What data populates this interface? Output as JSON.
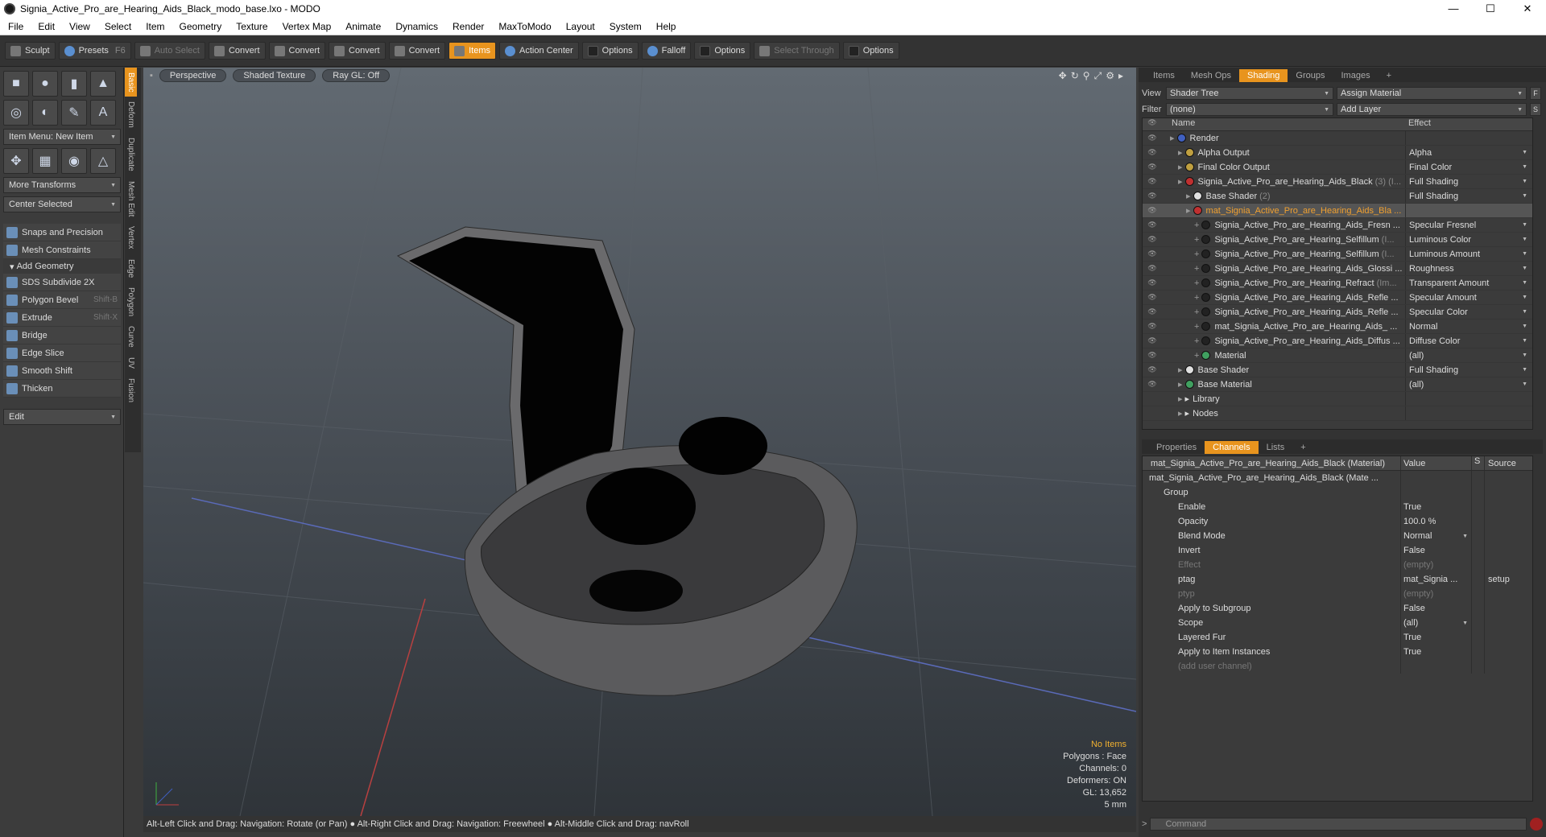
{
  "window": {
    "title": "Signia_Active_Pro_are_Hearing_Aids_Black_modo_base.lxo - MODO",
    "min": "—",
    "max": "☐",
    "close": "✕"
  },
  "menu": [
    "File",
    "Edit",
    "View",
    "Select",
    "Item",
    "Geometry",
    "Texture",
    "Vertex Map",
    "Animate",
    "Dynamics",
    "Render",
    "MaxToModo",
    "Layout",
    "System",
    "Help"
  ],
  "toolbar": {
    "sculpt": "Sculpt",
    "presets": "Presets",
    "presets_key": "F6",
    "auto_select": "Auto Select",
    "convert": "Convert",
    "items": "Items",
    "action_center": "Action Center",
    "options": "Options",
    "falloff": "Falloff",
    "select_through": "Select Through"
  },
  "left": {
    "item_menu": "Item Menu: New Item",
    "more_transforms": "More Transforms",
    "center_selected": "Center Selected",
    "snaps": "Snaps and Precision",
    "constraints": "Mesh Constraints",
    "add_geometry": "Add Geometry",
    "tools": [
      {
        "label": "SDS Subdivide 2X",
        "key": ""
      },
      {
        "label": "Polygon Bevel",
        "key": "Shift-B"
      },
      {
        "label": "Extrude",
        "key": "Shift-X"
      },
      {
        "label": "Bridge",
        "key": ""
      },
      {
        "label": "Edge Slice",
        "key": ""
      },
      {
        "label": "Smooth Shift",
        "key": ""
      },
      {
        "label": "Thicken",
        "key": ""
      }
    ],
    "edit": "Edit"
  },
  "vtabs": [
    "Basic",
    "Deform",
    "Duplicate",
    "Mesh Edit",
    "Vertex",
    "Edge",
    "Polygon",
    "Curve",
    "UV",
    "Fusion"
  ],
  "viewport": {
    "perspective": "Perspective",
    "shaded": "Shaded Texture",
    "raygl": "Ray GL: Off",
    "info": {
      "items": "No Items",
      "polygons": "Polygons : Face",
      "channels": "Channels: 0",
      "deformers": "Deformers: ON",
      "gl": "GL: 13,652",
      "scale": "5 mm"
    }
  },
  "status": "Alt-Left Click and Drag: Navigation: Rotate (or Pan) ● Alt-Right Click and Drag: Navigation: Freewheel ● Alt-Middle Click and Drag: navRoll",
  "right": {
    "tabs": [
      "Items",
      "Mesh Ops",
      "Shading",
      "Groups",
      "Images",
      "+"
    ],
    "view_label": "View",
    "view_value": "Shader Tree",
    "assign": "Assign Material",
    "f": "F",
    "filter_label": "Filter",
    "filter_value": "(none)",
    "add_layer": "Add Layer",
    "s": "S",
    "col_name": "Name",
    "col_effect": "Effect",
    "rows": [
      {
        "name": "Render",
        "dim": "",
        "effect": "",
        "indent": 1,
        "color": "#4060c0",
        "sel": false
      },
      {
        "name": "Alpha Output",
        "dim": "",
        "effect": "Alpha",
        "indent": 2,
        "color": "#c0a040",
        "sel": false
      },
      {
        "name": "Final Color Output",
        "dim": "",
        "effect": "Final Color",
        "indent": 2,
        "color": "#c0a040",
        "sel": false
      },
      {
        "name": "Signia_Active_Pro_are_Hearing_Aids_Black",
        "dim": "(3) (I...",
        "effect": "Full Shading",
        "indent": 2,
        "color": "#c03030",
        "sel": false
      },
      {
        "name": "Base Shader",
        "dim": "(2)",
        "effect": "Full Shading",
        "indent": 3,
        "color": "#e0e0e0",
        "sel": false
      },
      {
        "name": "mat_Signia_Active_Pro_are_Hearing_Aids_Bla ...",
        "dim": "",
        "effect": "",
        "indent": 3,
        "color": "#c03030",
        "sel": true
      },
      {
        "name": "Signia_Active_Pro_are_Hearing_Aids_Fresn ...",
        "dim": "",
        "effect": "Specular Fresnel",
        "indent": 4,
        "color": "#222",
        "sel": false
      },
      {
        "name": "Signia_Active_Pro_are_Hearing_Selfillum",
        "dim": "(I...",
        "effect": "Luminous Color",
        "indent": 4,
        "color": "#222",
        "sel": false
      },
      {
        "name": "Signia_Active_Pro_are_Hearing_Selfillum",
        "dim": "(I...",
        "effect": "Luminous Amount",
        "indent": 4,
        "color": "#222",
        "sel": false
      },
      {
        "name": "Signia_Active_Pro_are_Hearing_Aids_Glossi ...",
        "dim": "",
        "effect": "Roughness",
        "indent": 4,
        "color": "#222",
        "sel": false
      },
      {
        "name": "Signia_Active_Pro_are_Hearing_Refract",
        "dim": "(Im...",
        "effect": "Transparent Amount",
        "indent": 4,
        "color": "#222",
        "sel": false
      },
      {
        "name": "Signia_Active_Pro_are_Hearing_Aids_Refle ...",
        "dim": "",
        "effect": "Specular Amount",
        "indent": 4,
        "color": "#222",
        "sel": false
      },
      {
        "name": "Signia_Active_Pro_are_Hearing_Aids_Refle ...",
        "dim": "",
        "effect": "Specular Color",
        "indent": 4,
        "color": "#222",
        "sel": false
      },
      {
        "name": "mat_Signia_Active_Pro_are_Hearing_Aids_ ...",
        "dim": "",
        "effect": "Normal",
        "indent": 4,
        "color": "#222",
        "sel": false
      },
      {
        "name": "Signia_Active_Pro_are_Hearing_Aids_Diffus ...",
        "dim": "",
        "effect": "Diffuse Color",
        "indent": 4,
        "color": "#222",
        "sel": false
      },
      {
        "name": "Material",
        "dim": "",
        "effect": "(all)",
        "indent": 4,
        "color": "#40a060",
        "sel": false
      },
      {
        "name": "Base Shader",
        "dim": "",
        "effect": "Full Shading",
        "indent": 2,
        "color": "#e0e0e0",
        "sel": false
      },
      {
        "name": "Base Material",
        "dim": "",
        "effect": "(all)",
        "indent": 2,
        "color": "#40a060",
        "sel": false
      },
      {
        "name": "Library",
        "dim": "",
        "effect": "",
        "indent": 2,
        "color": "",
        "sel": false
      },
      {
        "name": "Nodes",
        "dim": "",
        "effect": "",
        "indent": 2,
        "color": "",
        "sel": false
      }
    ],
    "ptabs": [
      "Properties",
      "Channels",
      "Lists",
      "+"
    ],
    "ch_header": {
      "name": "mat_Signia_Active_Pro_are_Hearing_Aids_Black (Material)",
      "value": "Value",
      "s": "S",
      "source": "Source"
    },
    "ch_rows": [
      {
        "name": "mat_Signia_Active_Pro_are_Hearing_Aids_Black (Mate ...",
        "value": "",
        "source": "",
        "ind": 0
      },
      {
        "name": "Group",
        "value": "",
        "source": "",
        "ind": 1
      },
      {
        "name": "Enable",
        "value": "True",
        "source": "",
        "ind": 2
      },
      {
        "name": "Opacity",
        "value": "100.0 %",
        "source": "",
        "ind": 2
      },
      {
        "name": "Blend Mode",
        "value": "Normal",
        "source": "",
        "ind": 2,
        "dd": true
      },
      {
        "name": "Invert",
        "value": "False",
        "source": "",
        "ind": 2
      },
      {
        "name": "Effect",
        "value": "(empty)",
        "source": "",
        "ind": 2,
        "em": true
      },
      {
        "name": "ptag",
        "value": "mat_Signia ...",
        "source": "setup",
        "ind": 2
      },
      {
        "name": "ptyp",
        "value": "(empty)",
        "source": "",
        "ind": 2,
        "em": true
      },
      {
        "name": "Apply to Subgroup",
        "value": "False",
        "source": "",
        "ind": 2
      },
      {
        "name": "Scope",
        "value": "(all)",
        "source": "",
        "ind": 2,
        "dd": true
      },
      {
        "name": "Layered Fur",
        "value": "True",
        "source": "",
        "ind": 2
      },
      {
        "name": "Apply to Item Instances",
        "value": "True",
        "source": "",
        "ind": 2
      },
      {
        "name": "(add user channel)",
        "value": "",
        "source": "",
        "ind": 2,
        "em": true
      }
    ],
    "command": "Command"
  }
}
